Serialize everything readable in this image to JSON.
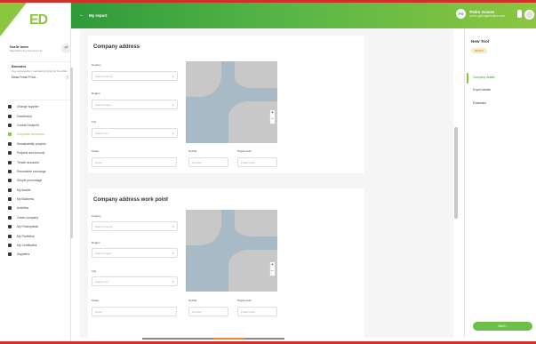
{
  "app": {
    "logo_text": "ED"
  },
  "topbar": {
    "back_icon": "arrow-left-icon",
    "title": "My report"
  },
  "user": {
    "initials": "PG",
    "name": "Pedro Gomes",
    "email": "pedro.g@organization.com"
  },
  "sidebar": {
    "org_name": "Noelle lanes",
    "org_sub": "Manufacturing Services Ltd.",
    "supplier_title": "Barcodes",
    "supplier_desc": "Use as bespoke / mandatory fields for the ESG",
    "supplier_select": "Dead Fresh Prod...",
    "items": [
      {
        "label": "Change supplier",
        "icon": "swap-icon",
        "active": false
      },
      {
        "label": "Dashboard",
        "icon": "dashboard-icon",
        "active": false
      },
      {
        "label": "Contact footprint",
        "icon": "footprint-icon",
        "active": false
      },
      {
        "label": "Corporate resources",
        "icon": "resources-icon",
        "active": true
      },
      {
        "label": "Sustainability projects",
        "icon": "leaf-icon",
        "active": false
      },
      {
        "label": "Projects and schools",
        "icon": "school-icon",
        "active": false
      },
      {
        "label": "Tender accounts",
        "icon": "document-icon",
        "active": false
      },
      {
        "label": "Renewable exchange",
        "icon": "exchange-icon",
        "active": false
      },
      {
        "label": "Simple percentage",
        "icon": "percent-icon",
        "active": false
      },
      {
        "label": "My Assets",
        "icon": "asset-icon",
        "active": false
      },
      {
        "label": "My Business",
        "icon": "business-icon",
        "active": false
      },
      {
        "label": "Activities",
        "icon": "check-icon",
        "active": false
      },
      {
        "label": "Green company",
        "icon": "company-icon",
        "active": false
      },
      {
        "label": "My Powerplants",
        "icon": "plant-icon",
        "active": false
      },
      {
        "label": "My Portfolios",
        "icon": "portfolio-icon",
        "active": false
      },
      {
        "label": "My Certificates",
        "icon": "certificate-icon",
        "active": false
      },
      {
        "label": "Suppliers",
        "icon": "supplier-icon",
        "active": false
      }
    ]
  },
  "sections": [
    {
      "title": "Company address",
      "country_label": "Country",
      "country_ph": "Search country",
      "region_label": "Region",
      "region_ph": "Search region",
      "city_label": "City",
      "city_ph": "Search city",
      "street_label": "Street",
      "street_ph": "Street",
      "number_label": "No/Nbr",
      "number_ph": "Number",
      "postal_label": "Postal code",
      "postal_ph": "Postal code"
    },
    {
      "title": "Company address work point",
      "country_label": "Country",
      "country_ph": "Search country",
      "region_label": "Region",
      "region_ph": "Search region",
      "city_label": "City",
      "city_ph": "Search city",
      "street_label": "Street",
      "street_ph": "Street",
      "number_label": "No/Nbr",
      "number_ph": "Number",
      "postal_label": "Postal code",
      "postal_ph": "Postal code"
    }
  ],
  "map": {
    "zoom_in": "+",
    "zoom_out": "−"
  },
  "right_panel": {
    "title": "New Tool",
    "badge": "DRAFT",
    "steps": [
      {
        "label": "Company details",
        "active": true
      },
      {
        "label": "Export details",
        "active": false
      },
      {
        "label": "Emissions",
        "active": false
      }
    ],
    "next_button": "Next  >"
  }
}
